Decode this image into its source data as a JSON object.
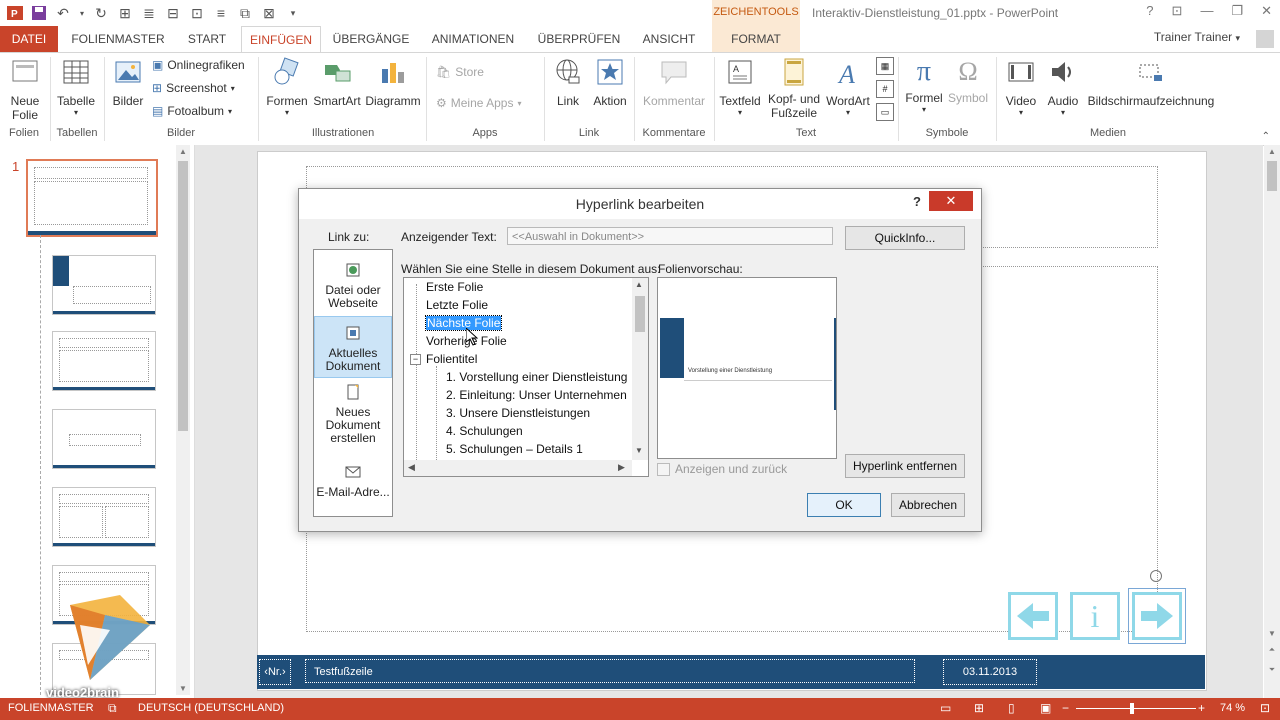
{
  "titlebar": {
    "context_tools": "ZEICHENTOOLS",
    "document_title": "Interaktiv-Dienstleistung_01.pptx - PowerPoint",
    "help": "?"
  },
  "tabs": {
    "datei": "DATEI",
    "folienmaster": "FOLIENMASTER",
    "start": "START",
    "einfuegen": "EINFÜGEN",
    "uebergaenge": "ÜBERGÄNGE",
    "animationen": "ANIMATIONEN",
    "ueberpruefen": "ÜBERPRÜFEN",
    "ansicht": "ANSICHT",
    "format": "FORMAT",
    "user": "Trainer Trainer"
  },
  "ribbon": {
    "neue_folie": "Neue Folie",
    "tabelle": "Tabelle",
    "bilder": "Bilder",
    "onlinegrafiken": "Onlinegrafiken",
    "screenshot": "Screenshot",
    "fotoalbum": "Fotoalbum",
    "formen": "Formen",
    "smartart": "SmartArt",
    "diagramm": "Diagramm",
    "store": "Store",
    "meine_apps": "Meine Apps",
    "link": "Link",
    "aktion": "Aktion",
    "kommentar": "Kommentar",
    "textfeld": "Textfeld",
    "kopf_fusszeile_1": "Kopf- und",
    "kopf_fusszeile_2": "Fußzeile",
    "wordart": "WordArt",
    "formel": "Formel",
    "symbol": "Symbol",
    "video": "Video",
    "audio": "Audio",
    "bildschirmaufzeichnung": "Bildschirmaufzeichnung",
    "groups": {
      "folien": "Folien",
      "tabellen": "Tabellen",
      "bilder": "Bilder",
      "illustrationen": "Illustrationen",
      "apps": "Apps",
      "link": "Link",
      "kommentare": "Kommentare",
      "text": "Text",
      "symbole": "Symbole",
      "medien": "Medien"
    }
  },
  "slidepanel": {
    "slide_number": "1"
  },
  "slide": {
    "footer_nr": "‹Nr.›",
    "footer_text": "Testfußzeile",
    "footer_date": "03.11.2013"
  },
  "nav_buttons": {
    "info": "i"
  },
  "statusbar": {
    "view": "FOLIENMASTER",
    "language": "DEUTSCH (DEUTSCHLAND)",
    "zoom": "74 %"
  },
  "dialog": {
    "title": "Hyperlink bearbeiten",
    "help": "?",
    "close": "✕",
    "link_zu": "Link zu:",
    "anzeigender_text_label": "Anzeigender Text:",
    "anzeigender_text_value": "<<Auswahl in Dokument>>",
    "quickinfo": "QuickInfo...",
    "waehlen_label": "Wählen Sie eine Stelle in diesem Dokument aus:",
    "folienvorschau": "Folienvorschau:",
    "link_options": [
      {
        "l1": "Datei oder",
        "l2": "Webseite"
      },
      {
        "l1": "Aktuelles",
        "l2": "Dokument"
      },
      {
        "l1": "Neues",
        "l2": "Dokument",
        "l3": "erstellen"
      },
      {
        "l1": "E-Mail-Adre..."
      }
    ],
    "tree": {
      "erste": "Erste Folie",
      "letzte": "Letzte Folie",
      "naechste": "Nächste Folie",
      "vorherige": "Vorherige Folie",
      "folientitel": "Folientitel",
      "items": [
        "1. Vorstellung einer Dienstleistung",
        "2. Einleitung: Unser Unternehmen",
        "3. Unsere Dienstleistungen",
        "4. Schulungen",
        "5. Schulungen – Details 1"
      ]
    },
    "preview_text": "Vorstellung einer Dienstleistung",
    "anzeigen_zurueck": "Anzeigen und zurück",
    "hyperlink_entfernen": "Hyperlink entfernen",
    "ok": "OK",
    "abbrechen": "Abbrechen"
  },
  "watermark": "video2brain"
}
